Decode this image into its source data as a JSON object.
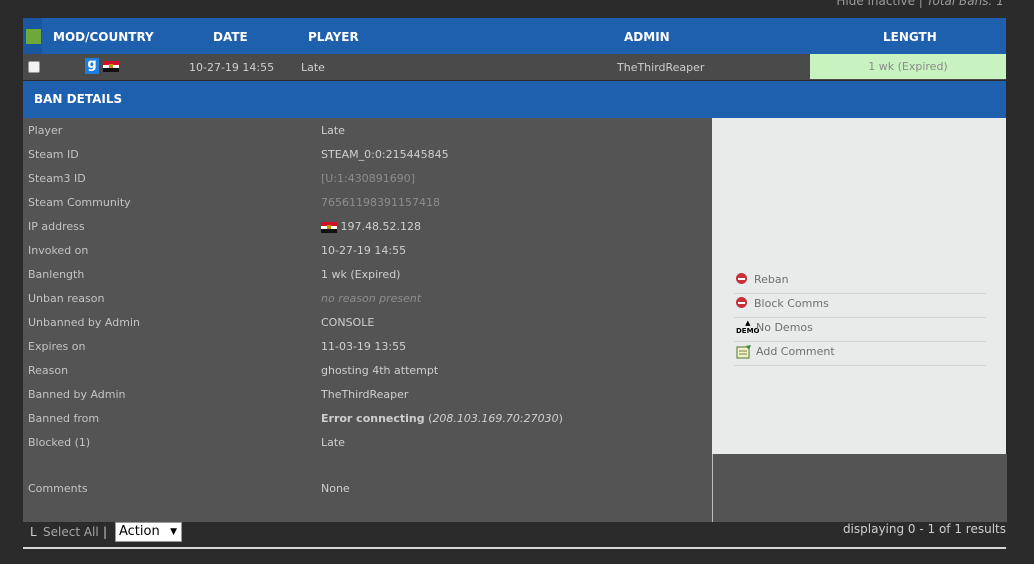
{
  "top_bar": {
    "hide_inactive": "Hide inactive",
    "separator": "|",
    "total_bans": "Total Bans: 1"
  },
  "table_header": {
    "mod_country": "MOD/COUNTRY",
    "date": "DATE",
    "player": "PLAYER",
    "admin": "ADMIN",
    "length": "LENGTH"
  },
  "ban_row": {
    "mod_icon_text": "g",
    "mod_icon": "gmod-icon",
    "country_flag": "egypt-flag-icon",
    "date": "10-27-19 14:55",
    "player": "Late",
    "admin": "TheThirdReaper",
    "length": "1 wk (Expired)",
    "length_bg_color": "#c9f2c1"
  },
  "details_title": "BAN DETAILS",
  "details": [
    {
      "label": "Player",
      "value": "Late"
    },
    {
      "label": "Steam ID",
      "value": "STEAM_0:0:215445845"
    },
    {
      "label": "Steam3 ID",
      "value": "[U:1:430891690]"
    },
    {
      "label": "Steam Community",
      "value": "76561198391157418"
    },
    {
      "label": "IP address",
      "value": "197.48.52.128"
    },
    {
      "label": "Invoked on",
      "value": "10-27-19 14:55"
    },
    {
      "label": "Banlength",
      "value": "1 wk (Expired)"
    },
    {
      "label": "Unban reason",
      "value": "no reason present"
    },
    {
      "label": "Unbanned by Admin",
      "value": "CONSOLE"
    },
    {
      "label": "Expires on",
      "value": "11-03-19 13:55"
    },
    {
      "label": "Reason",
      "value": "ghosting 4th attempt"
    },
    {
      "label": "Banned by Admin",
      "value": "TheThirdReaper"
    },
    {
      "label": "Banned from",
      "value_bold": "Error connecting",
      "value_paren_open": "(",
      "value_server": "208.103.169.70:27030",
      "value_paren_close": ")"
    },
    {
      "label": "Blocked (1)",
      "value": "Late"
    },
    {
      "label": "Comments",
      "value": "None"
    }
  ],
  "actions": {
    "reban": "Reban",
    "block_comms": "Block Comms",
    "no_demos": "No Demos",
    "demo_icon_text": "DEMO",
    "add_comment": "Add Comment"
  },
  "footer": {
    "corner": "L",
    "select_all": "Select All",
    "separator": "|",
    "action_select": "Action",
    "results": "displaying 0 - 1 of 1 results"
  },
  "colors": {
    "header_blue": "#1e5fae",
    "expired_green": "#c9f2c1",
    "panel_gray": "#545454",
    "sidebar_light": "#e9eaea",
    "minus_red": "#c7313a"
  }
}
